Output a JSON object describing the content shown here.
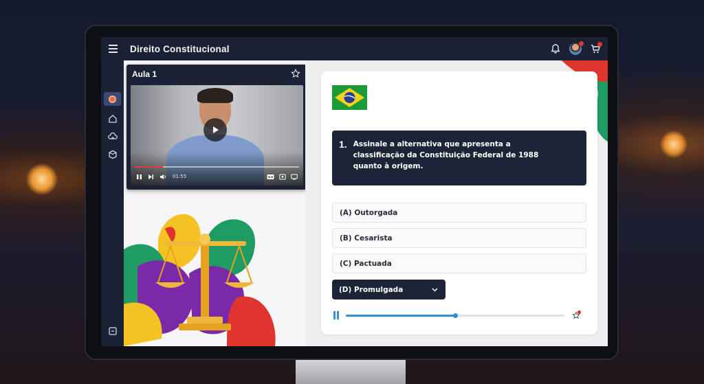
{
  "app": {
    "title": "Direito Constitucional"
  },
  "topbar": {
    "icons": [
      "menu-icon",
      "bell-icon",
      "avatar",
      "cart-icon"
    ],
    "colors": {
      "bar": "#1a2135",
      "notification": "#e0342f"
    }
  },
  "sidebar": {
    "items": [
      {
        "icon": "course-icon",
        "active": true
      },
      {
        "icon": "home-icon",
        "active": false
      },
      {
        "icon": "cloud-icon",
        "active": false
      },
      {
        "icon": "box-icon",
        "active": false
      },
      {
        "icon": "collapse-icon",
        "active": false
      }
    ]
  },
  "video": {
    "title": "Aula 1",
    "time": "01:55",
    "progress": 0.17,
    "controls": [
      "pause-icon",
      "next-icon",
      "volume-icon",
      "subtitles-icon",
      "settings-icon",
      "fullscreen-icon"
    ]
  },
  "quiz": {
    "flag": "brazil-flag",
    "question_number": "1.",
    "question_text": "Assinale a alternativa que apresenta a classificação da Constituição Federal de 1988 quanto à origem.",
    "options": [
      {
        "label": "(A) Outorgada"
      },
      {
        "label": "(B) Cesarista"
      },
      {
        "label": "(C) Pactuada"
      }
    ],
    "selected_option": "(D) Promulgada",
    "audio_progress": 0.5,
    "colors": {
      "accent": "#2f8fd8",
      "dark": "#1d2438"
    }
  }
}
